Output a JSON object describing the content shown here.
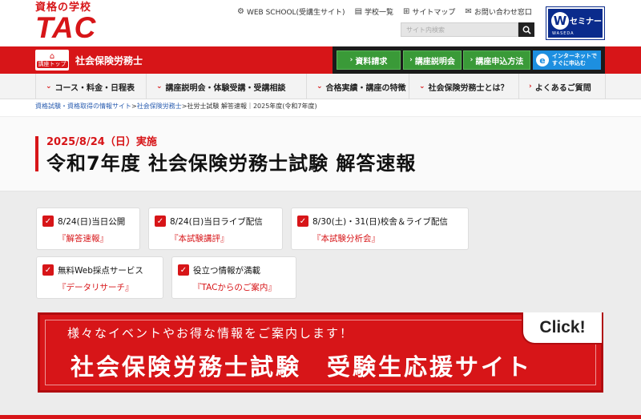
{
  "header": {
    "logo_sub": "資格の学校",
    "logo_main": "TAC",
    "util_links": [
      {
        "icon": "gear-icon",
        "label": "WEB SCHOOL(受講生サイト)"
      },
      {
        "icon": "book-icon",
        "label": "学校一覧"
      },
      {
        "icon": "sitemap-icon",
        "label": "サイトマップ"
      },
      {
        "icon": "mail-icon",
        "label": "お問い合わせ窓口"
      }
    ],
    "search_placeholder": "サイト内検索",
    "wseminar_title": "セミナー",
    "wseminar_sub": "WASEDA"
  },
  "course_bar": {
    "icon_label": "講座トップ",
    "course_name": "社会保険労務士",
    "actions": [
      "資料請求",
      "講座説明会",
      "講座申込方法"
    ],
    "net_apply_line1": "インターネットで",
    "net_apply_line2": "すぐに申込む"
  },
  "nav": {
    "items": [
      "コース・料金・日程表",
      "講座説明会・体験受講・受講相談",
      "合格実績・講座の特徴",
      "社会保険労務士とは？",
      "よくあるご質問"
    ]
  },
  "breadcrumb": {
    "link1": "資格試験・資格取得の情報サイト",
    "link2": "社会保険労務士",
    "current": ">社労士試験 解答速報｜2025年度(令和7年度)"
  },
  "title": {
    "date": "2025/8/24（日）実施",
    "main": "令和7年度 社会保険労務士試験 解答速報"
  },
  "cards": [
    {
      "line1": "8/24(日)当日公開",
      "line2": "『解答速報』"
    },
    {
      "line1": "8/24(日)当日ライブ配信",
      "line2": "『本試験講評』"
    },
    {
      "line1": "8/30(土)・31(日)校舎＆ライブ配信",
      "line2": "『本試験分析会』"
    },
    {
      "line1": "無料Web採点サービス",
      "line2": "『データリサーチ』"
    },
    {
      "line1": "役立つ情報が満載",
      "line2": "『TACからのご案内』"
    }
  ],
  "banner": {
    "sub": "様々なイベントやお得な情報をご案内します！",
    "main": "社会保険労務士試験　受験生応援サイト",
    "click": "Click!"
  }
}
